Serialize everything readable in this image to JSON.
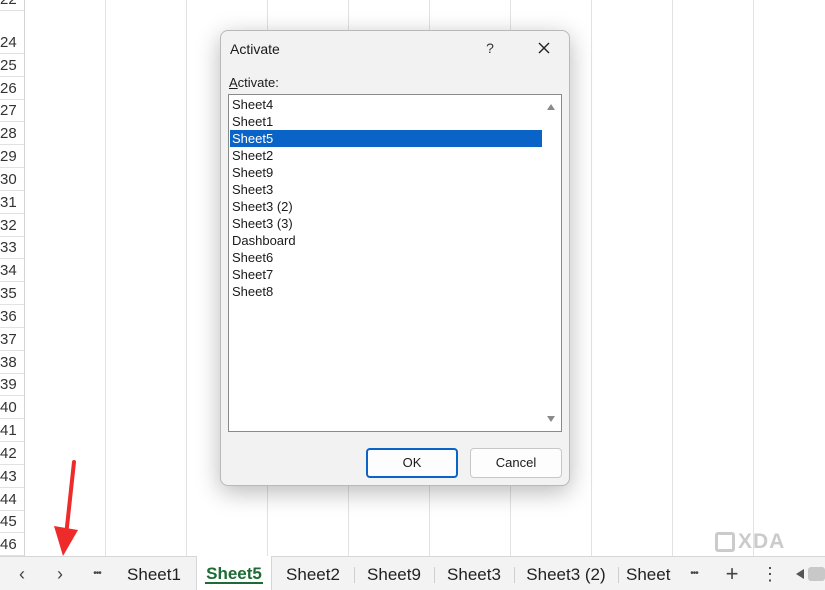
{
  "spreadsheet": {
    "row_numbers": [
      "22",
      "24",
      "25",
      "26",
      "27",
      "28",
      "29",
      "30",
      "31",
      "32",
      "33",
      "34",
      "35",
      "36",
      "37",
      "38",
      "39",
      "40",
      "41",
      "42",
      "43",
      "44",
      "45",
      "46"
    ]
  },
  "dialog": {
    "title": "Activate",
    "help_label": "?",
    "list_label_prefix": "A",
    "list_label_rest": "ctivate:",
    "items": [
      "Sheet4",
      "Sheet1",
      "Sheet5",
      "Sheet2",
      "Sheet9",
      "Sheet3",
      "Sheet3 (2)",
      "Sheet3 (3)",
      "Dashboard",
      "Sheet6",
      "Sheet7",
      "Sheet8"
    ],
    "selected": "Sheet5",
    "ok_label": "OK",
    "cancel_label": "Cancel",
    "accent_color": "#0a64c8"
  },
  "tabbar": {
    "prev_icon": "‹",
    "next_icon": "›",
    "more_left": "•••",
    "tabs": [
      "Sheet1",
      "Sheet5",
      "Sheet2",
      "Sheet9",
      "Sheet3",
      "Sheet3 (2)",
      "Sheet"
    ],
    "active_tab": "Sheet5",
    "more_right": "•••",
    "add_icon": "+",
    "options_icon": "⋮",
    "active_color": "#1e6b35"
  },
  "watermark": {
    "text": "XDA"
  },
  "annotation": {
    "arrow_color": "#ee2b2b"
  }
}
